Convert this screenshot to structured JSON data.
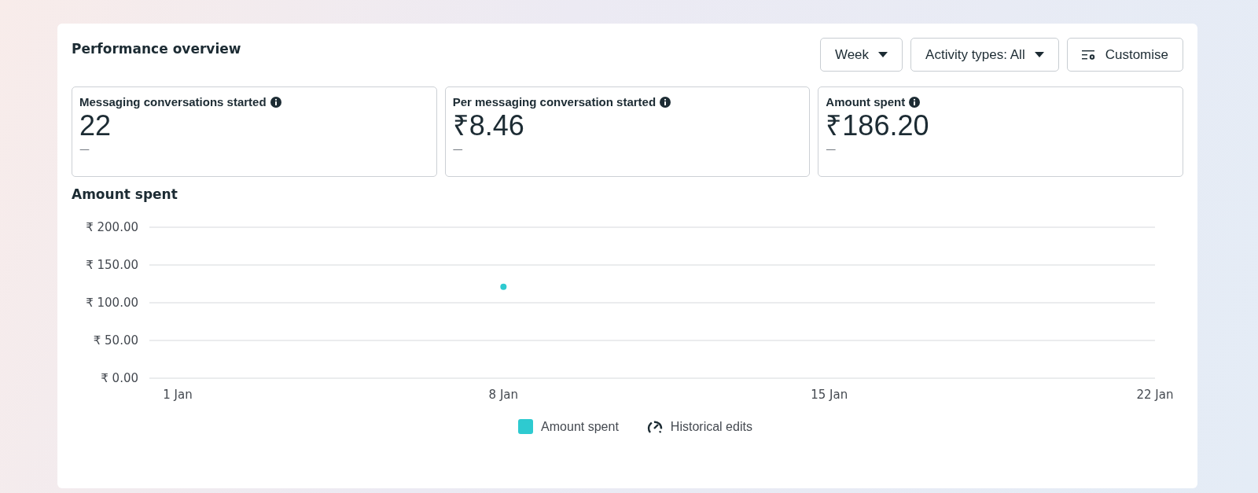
{
  "panel": {
    "title": "Performance overview"
  },
  "controls": [
    {
      "kind": "dropdown",
      "label": "Week"
    },
    {
      "kind": "dropdown",
      "label": "Activity types: All"
    },
    {
      "kind": "customise",
      "label": "Customise"
    }
  ],
  "metrics": [
    {
      "label": "Messaging conversations started",
      "value": "22",
      "change": "—"
    },
    {
      "label": "Per messaging conversation started",
      "value": "₹8.46",
      "change": "—"
    },
    {
      "label": "Amount spent",
      "value": "₹186.20",
      "change": "—"
    }
  ],
  "chart": {
    "title": "Amount spent",
    "chart_data": {
      "type": "scatter",
      "categories": [
        "1 Jan",
        "8 Jan",
        "15 Jan",
        "22 Jan"
      ],
      "series": [
        {
          "name": "Amount spent",
          "color": "#2ecad0",
          "values": [
            null,
            121,
            null,
            null
          ]
        }
      ],
      "ylim": [
        0,
        200
      ],
      "grid": true,
      "yticks": [
        {
          "value": 0,
          "label": "₹ 0.00"
        },
        {
          "value": 50,
          "label": "₹ 50.00"
        },
        {
          "value": 100,
          "label": "₹ 100.00"
        },
        {
          "value": 150,
          "label": "₹ 150.00"
        },
        {
          "value": 200,
          "label": "₹ 200.00"
        }
      ]
    },
    "legend": [
      {
        "kind": "gauge",
        "label": "Historical edits"
      }
    ]
  }
}
